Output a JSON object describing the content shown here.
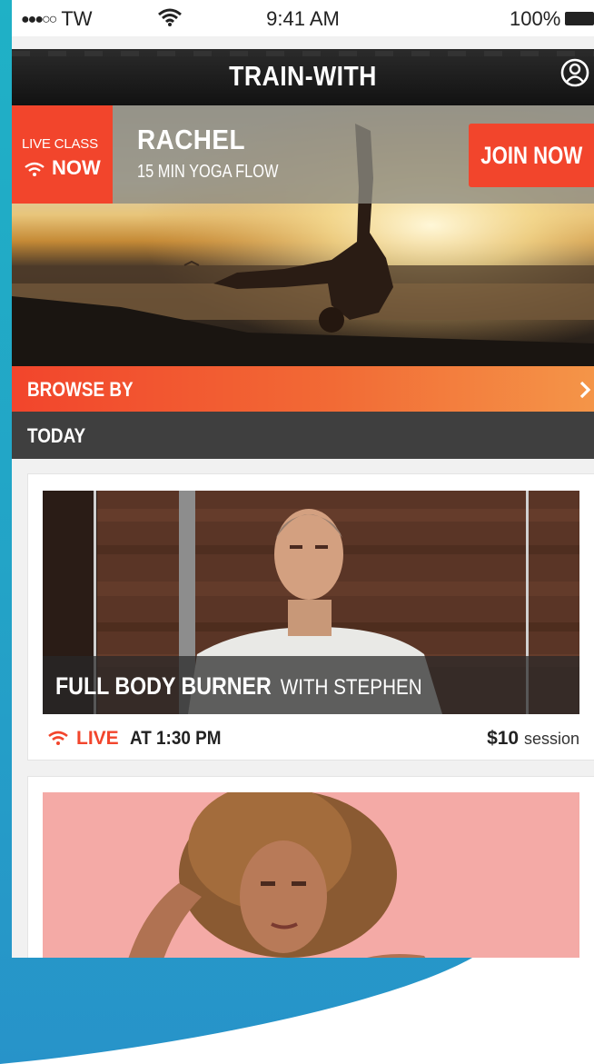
{
  "status_bar": {
    "carrier": "TW",
    "time": "9:41 AM",
    "battery": "100%"
  },
  "nav": {
    "title": "TRAIN-WITH",
    "profile_icon": "user-circle-icon"
  },
  "hero": {
    "badge_line1": "LIVE CLASS",
    "badge_line2": "NOW",
    "instructor": "RACHEL",
    "class_title": "15 MIN YOGA FLOW",
    "join_label": "JOIN NOW"
  },
  "browse": {
    "label": "BROWSE BY",
    "icon": "chevron-right-icon"
  },
  "section": {
    "label": "TODAY"
  },
  "cards": [
    {
      "class_name": "FULL BODY BURNER",
      "with_text": "WITH STEPHEN",
      "live_label": "LIVE",
      "time_text": "AT 1:30 PM",
      "price": "$10",
      "price_unit": "session"
    }
  ],
  "colors": {
    "accent": "#f2452c",
    "nav_bg": "#121212",
    "section_bg": "#3f3f3f",
    "background_teal": "#1fb1c6"
  }
}
